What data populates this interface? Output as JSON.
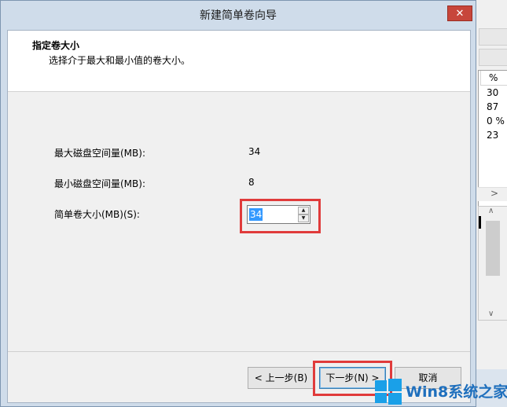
{
  "window": {
    "title": "新建简单卷向导",
    "close_glyph": "✕"
  },
  "header": {
    "title": "指定卷大小",
    "description": "选择介于最大和最小值的卷大小。"
  },
  "fields": {
    "max_label": "最大磁盘空间量(MB):",
    "max_value": "34",
    "min_label": "最小磁盘空间量(MB):",
    "min_value": "8",
    "size_label": "简单卷大小(MB)(S):",
    "size_value": "34"
  },
  "buttons": {
    "back": "< 上一步(B)",
    "next": "下一步(N) >",
    "cancel": "取消"
  },
  "background_window": {
    "column_header": "%",
    "cells": [
      "30",
      "87",
      "0 %",
      "23"
    ]
  },
  "watermark": {
    "text": "Win8系统之家"
  },
  "colors": {
    "highlight_box": "#e03b3b",
    "selection": "#3399ff",
    "close_button": "#c7463b"
  }
}
